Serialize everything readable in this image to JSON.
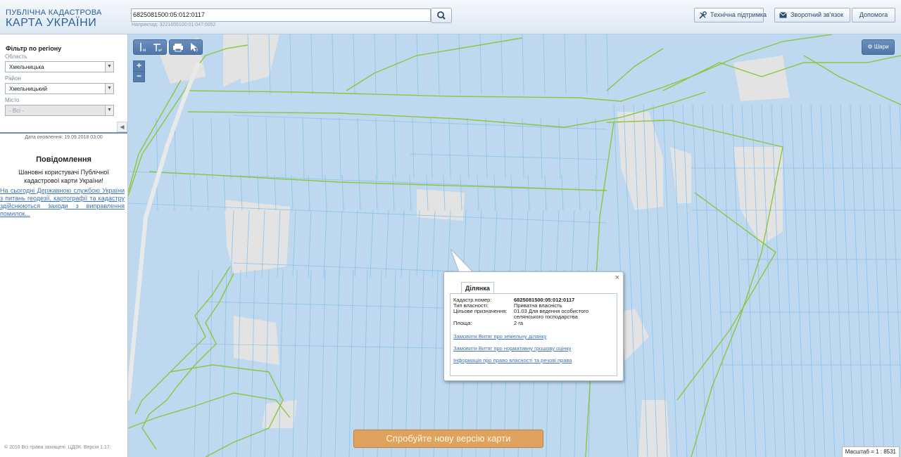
{
  "header": {
    "logo_line1": "ПУБЛІЧНА КАДАСТРОВА",
    "logo_line2": "КАРТА УКРАЇНИ",
    "search_value": "6825081500:05:012:0117",
    "search_hint": "Наприклад: 3221655100:01:047:0052",
    "support_label": "Технічна підтримка",
    "feedback_label": "Зворотний зв'язок",
    "help_label": "Допомога"
  },
  "sidebar": {
    "filter_title": "Фільтр по регіону",
    "region_label": "Область",
    "region_value": "Хмельницька",
    "district_label": "Район",
    "district_value": "Хмельницький",
    "city_label": "Місто",
    "city_value": "- Всі -",
    "update_date": "Дата оновлення: 19.09.2018 03:00",
    "notice_title": "Повідомлення",
    "notice_text": "Шановні користувачі Публічної кадастрової карти України!",
    "notice_link": "На сьогодні Державною службою України з питань геодезії, картографії та кадастру здійснюються заходи з виправлення помилок...",
    "copyright": "© 2016 Всі права захищені. ЦДЗК. Версія 1.17."
  },
  "map": {
    "layers_label": "Шари",
    "zoom_in": "+",
    "zoom_out": "−",
    "new_version_label": "Спробуйте нову версію карти",
    "scale_text": "Масштаб = 1 : 8531"
  },
  "popup": {
    "tab_label": "Ділянка",
    "cadastral_label": "Кадастр.номер:",
    "cadastral_value": "6825081500:05:012:0117",
    "ownership_label": "Тип власності:",
    "ownership_value": "Приватна власність",
    "purpose_label": "Цільове призначення:",
    "purpose_value": "01.03 Для ведення особистого селянського господарства",
    "area_label": "Площа:",
    "area_value": "2 га",
    "link1": "Замовити Витяг про земельну ділянку",
    "link2": "Замовити Витяг про нормативну грошову оцінку",
    "link3": "Інформація про право власності та речові права",
    "close": "×"
  },
  "colors": {
    "parcel_fill": "#bdd8ef",
    "parcel_stroke": "#8cc4ea",
    "boundary": "#8cc63f",
    "unassigned": "#e3e3e3",
    "accent": "#6b8fbc",
    "orange_button": "#e0a35f"
  }
}
